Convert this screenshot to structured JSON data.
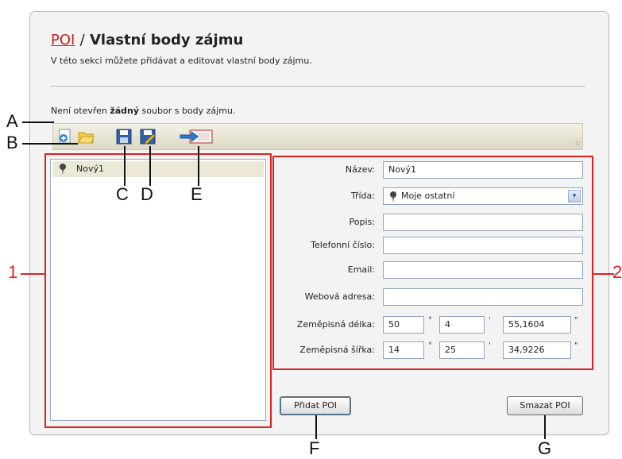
{
  "header": {
    "breadcrumb_link": "POI",
    "separator": "/",
    "title": "Vlastní body zájmu",
    "subtitle": "V této sekci můžete přidávat a editovat vlastní body zájmu."
  },
  "status": {
    "prefix": "Není otevřen ",
    "emphasis": "žádný",
    "suffix": " soubor s body zájmu."
  },
  "toolbar": {
    "buttons": [
      {
        "icon": "new-file-icon"
      },
      {
        "icon": "open-folder-icon"
      },
      {
        "icon": "save-icon"
      },
      {
        "icon": "save-as-icon"
      },
      {
        "icon": "export-icon"
      }
    ]
  },
  "poi_list": {
    "items": [
      {
        "label": "Nový1",
        "icon": "pin-icon"
      }
    ]
  },
  "form": {
    "name_label": "Název:",
    "name_value": "Nový1",
    "class_label": "Třída:",
    "class_value": "Moje ostatní",
    "description_label": "Popis:",
    "description_value": "",
    "phone_label": "Telefonní číslo:",
    "phone_value": "",
    "email_label": "Email:",
    "email_value": "",
    "web_label": "Webová adresa:",
    "web_value": "",
    "longitude_label": "Zeměpisná délka:",
    "longitude": {
      "deg": "50",
      "min": "4",
      "sec": "55,1604"
    },
    "latitude_label": "Zeměpisná šířka:",
    "latitude": {
      "deg": "14",
      "min": "25",
      "sec": "34,9226"
    },
    "deg_symbol": "°",
    "min_symbol": "'",
    "sec_symbol": "\""
  },
  "actions": {
    "add_label": "Přidat POI",
    "delete_label": "Smazat POI"
  },
  "callouts": {
    "a": "A",
    "b": "B",
    "c": "C",
    "d": "D",
    "e": "E",
    "f": "F",
    "g": "G",
    "one": "1",
    "two": "2"
  },
  "colors": {
    "accent_red": "#e12020",
    "link_red": "#c8251c",
    "selection": "#ebe9d6",
    "toolbar": "#dcd8c3"
  }
}
